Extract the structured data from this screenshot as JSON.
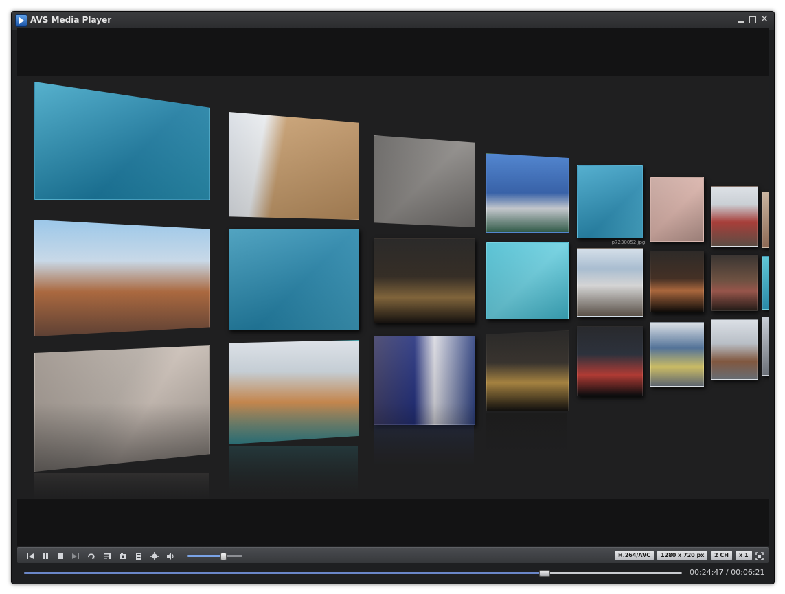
{
  "window": {
    "title": "AVS Media Player",
    "min_icon": "minimize-icon",
    "max_icon": "maximize-icon",
    "close_glyph": "✕"
  },
  "gallery": {
    "caption": "p7230052.jpg",
    "thumb_count": 21
  },
  "controls": {
    "buttons": [
      "previous-icon",
      "pause-icon",
      "stop-icon",
      "next-icon",
      "repeat-icon",
      "playlist-icon",
      "snapshot-icon",
      "document-icon",
      "settings-icon",
      "volume-icon"
    ],
    "volume_level": 0.65
  },
  "info": {
    "codec": "H.264/AVC",
    "resolution": "1280 x 720 px",
    "channels": "2 CH",
    "speed": "x 1"
  },
  "seek": {
    "position_fraction": 0.79,
    "current_time": "00:24:47",
    "separator": "/",
    "total_time": "00:06:21"
  },
  "colors": {
    "seek_fill": "#6a86c8",
    "volume_fill": "#7aa3e6"
  }
}
